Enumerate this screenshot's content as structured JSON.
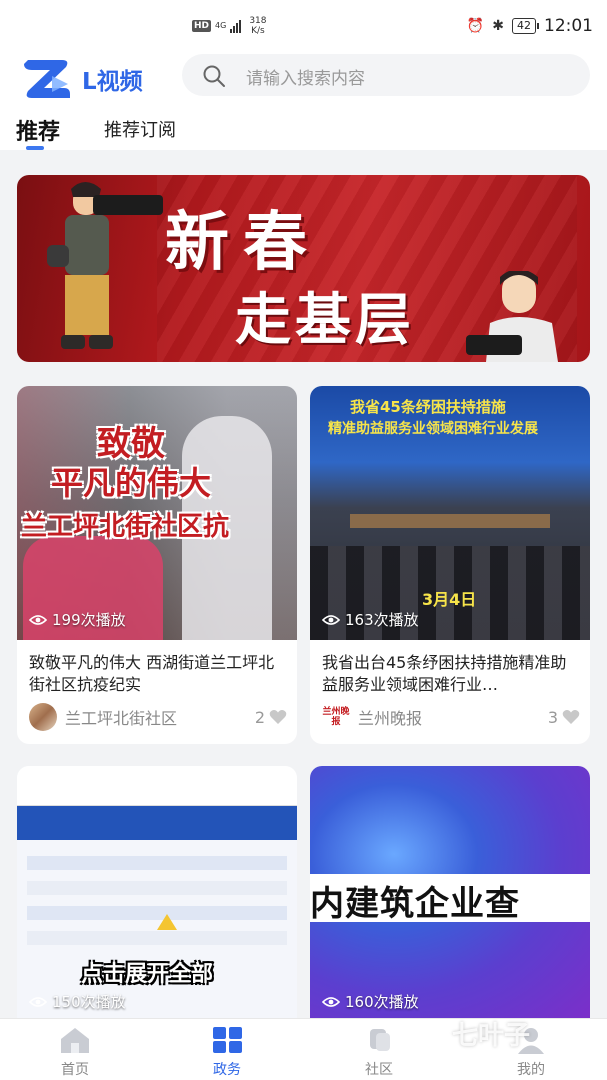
{
  "status_bar": {
    "net_badge": "HD",
    "net_type": "4G",
    "speed_value": "318",
    "speed_unit": "K/s",
    "battery": "42",
    "time": "12:01"
  },
  "header": {
    "app_name": "L视频",
    "search_placeholder": "请输入搜索内容",
    "tabs": [
      {
        "label": "推荐",
        "active": true
      },
      {
        "label": "推荐订阅",
        "active": false
      }
    ]
  },
  "banner": {
    "line1": "新春",
    "line2": "走基层"
  },
  "cards": [
    {
      "thumb_text_1": "致敬",
      "thumb_text_2": "平凡的伟大",
      "thumb_text_3": "兰工坪北街社区抗",
      "plays": "199次播放",
      "title": "致敬平凡的伟大 西湖街道兰工坪北街社区抗疫纪实",
      "author": "兰工坪北街社区",
      "likes": "2"
    },
    {
      "thumb_text_1": "我省45条纾困扶持措施",
      "thumb_text_2": "精准助益服务业领域困难行业发展",
      "thumb_text_3": "3月4日",
      "plays": "163次播放",
      "title": "我省出台45条纾困扶持措施精准助益服务业领域困难行业…",
      "author": "兰州晚报",
      "author_logo_text": "兰州晚报",
      "likes": "3"
    },
    {
      "thumb_text_1": "点击展开全部",
      "plays": "150次播放"
    },
    {
      "thumb_text_1": "内建筑企业查",
      "plays": "160次播放"
    }
  ],
  "bottom_nav": [
    {
      "label": "首页",
      "icon": "home-icon",
      "active": false
    },
    {
      "label": "政务",
      "icon": "grid-icon",
      "active": true
    },
    {
      "label": "社区",
      "icon": "community-icon",
      "active": false
    },
    {
      "label": "我的",
      "icon": "profile-icon",
      "active": false
    }
  ],
  "watermark": "七叶子",
  "colors": {
    "accent": "#2f67e6",
    "banner_red": "#c7262a"
  }
}
